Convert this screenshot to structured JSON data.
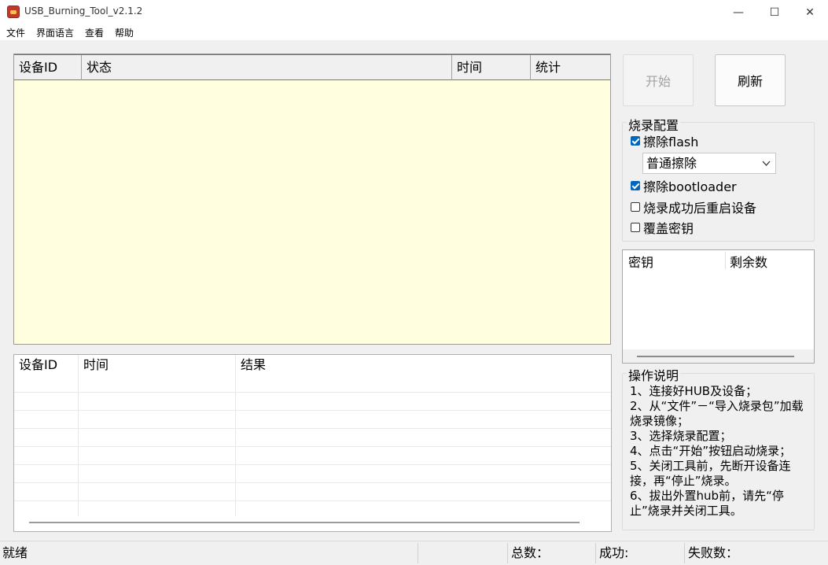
{
  "window": {
    "title": "USB_Burning_Tool_v2.1.2",
    "controls": {
      "minimize": "—",
      "maximize": "☐",
      "close": "✕"
    }
  },
  "menu": [
    "文件",
    "界面语言",
    "查看",
    "帮助"
  ],
  "device_table": {
    "columns": [
      "设备ID",
      "状态",
      "时间",
      "统计"
    ],
    "rows": []
  },
  "result_table": {
    "columns": [
      "设备ID",
      "时间",
      "结果"
    ],
    "rows": []
  },
  "buttons": {
    "start": "开始",
    "refresh": "刷新"
  },
  "burn_config": {
    "title": "烧录配置",
    "erase_flash": {
      "label": "擦除flash",
      "checked": true
    },
    "erase_mode": "普通擦除",
    "erase_bootloader": {
      "label": "擦除bootloader",
      "checked": true
    },
    "reboot_after": {
      "label": "烧录成功后重启设备",
      "checked": false
    },
    "overwrite_key": {
      "label": "覆盖密钥",
      "checked": false
    }
  },
  "key_table": {
    "columns": [
      "密钥",
      "剩余数"
    ]
  },
  "instructions": {
    "title": "操作说明",
    "text": "1、连接好HUB及设备；\n2、从“文件”－“导入烧录包”加载烧录镜像；\n3、选择烧录配置；\n4、点击“开始”按钮启动烧录；\n5、关闭工具前，先断开设备连接，再“停止”烧录。\n6、拔出外置hub前，请先“停止”烧录并关闭工具。"
  },
  "status": {
    "ready": "就绪",
    "total": "总数：",
    "success": "成功:",
    "fail": "失败数："
  }
}
